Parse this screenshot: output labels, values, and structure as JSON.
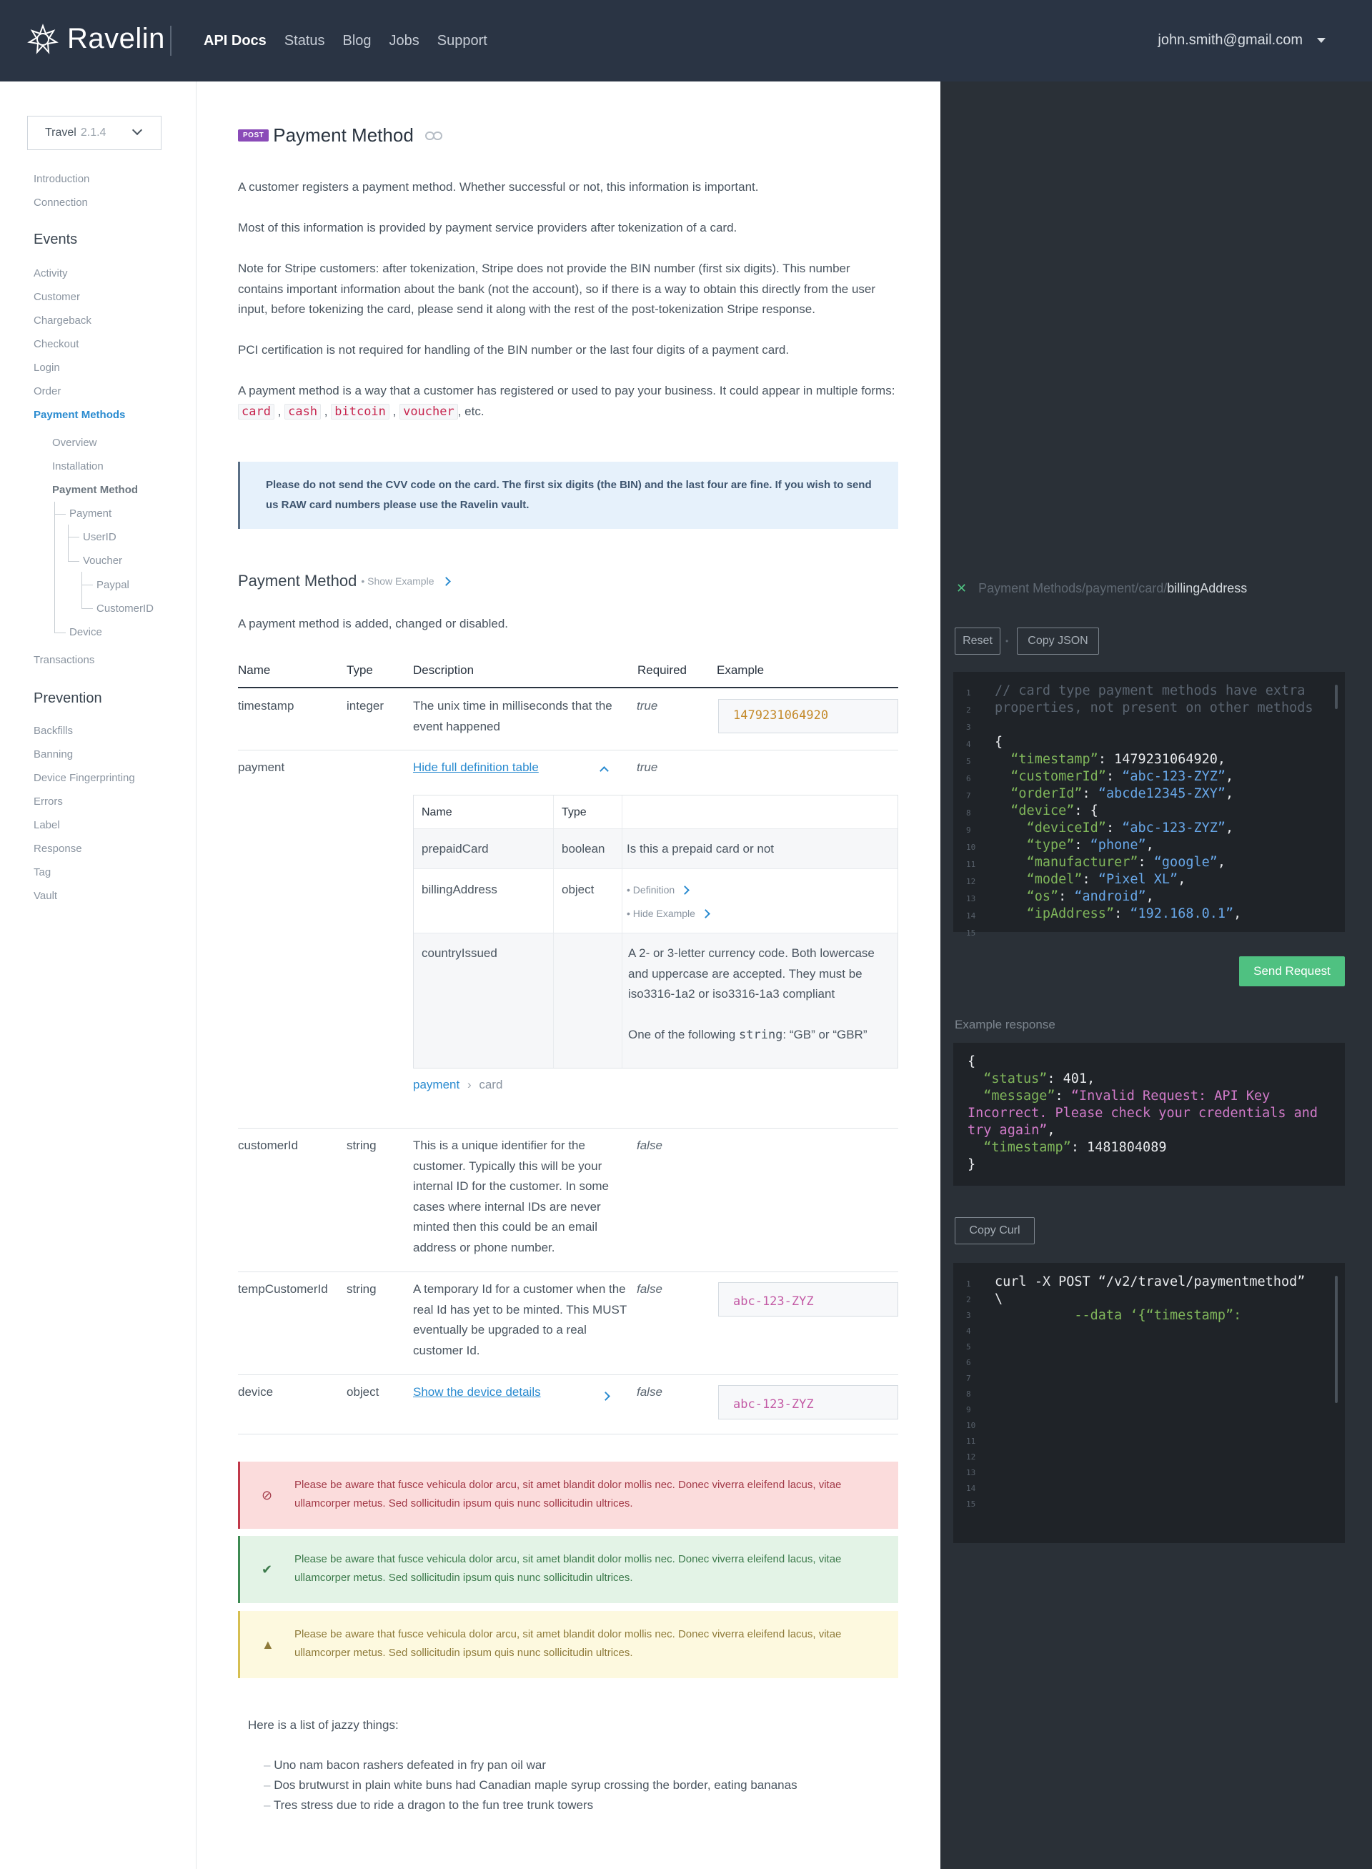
{
  "header": {
    "logo_text": "Ravelin",
    "nav": [
      {
        "label": "API Docs",
        "active": true
      },
      {
        "label": "Status",
        "active": false
      },
      {
        "label": "Blog",
        "active": false
      },
      {
        "label": "Jobs",
        "active": false
      },
      {
        "label": "Support",
        "active": false
      }
    ],
    "user_email": "john.smith@gmail.com"
  },
  "sidebar": {
    "version_label": "Travel",
    "version_number": "2.1.4",
    "intro": "Introduction",
    "connection": "Connection",
    "events_heading": "Events",
    "events": [
      "Activity",
      "Customer",
      "Chargeback",
      "Checkout",
      "Login",
      "Order",
      "Payment Methods"
    ],
    "payment_sub": [
      "Overview",
      "Installation",
      "Payment Method"
    ],
    "tree": [
      "Payment",
      "UserID",
      "Voucher",
      "Paypal",
      "CustomerID",
      "Device"
    ],
    "transactions": "Transactions",
    "prevention_heading": "Prevention",
    "prevention": [
      "Backfills",
      "Banning",
      "Device Fingerprinting",
      "Errors",
      "Label",
      "Response",
      "Tag",
      "Vault"
    ]
  },
  "content": {
    "method_badge": "POST",
    "title": "Payment Method",
    "p1": "A customer registers a payment method. Whether successful or not, this information is important.",
    "p2": "Most of this information is provided by payment service providers after tokenization of a card.",
    "p3": "Note for Stripe customers: after tokenization, Stripe does not provide the BIN number (first six digits). This number contains important information about the bank (not the account), so if there is a way to obtain this directly from the user input, before tokenizing the card, please send it along with the rest of the post-tokenization Stripe response.",
    "p4": "PCI certification is not required for handling of the BIN number or the last four digits of a payment card.",
    "p5_prefix": "A payment method is a way that a customer has registered or used to pay your business. It could appear in multiple forms:",
    "p5_codes": [
      "card",
      "cash",
      "bitcoin",
      "voucher"
    ],
    "p5_suffix": ", etc.",
    "info": "Please do not send the CVV code on the card. The first six digits (the BIN) and the last four are fine. If you wish to send us RAW card numbers please use the Ravelin vault.",
    "section_title": "Payment Method",
    "show_example": "Show Example",
    "section_desc": "A payment method is added, changed or disabled.",
    "table_headers": [
      "Name",
      "Type",
      "Description",
      "Required",
      "Example"
    ],
    "rows": {
      "timestamp": {
        "name": "timestamp",
        "type": "integer",
        "desc": "The unix time in milliseconds that the event happened",
        "req": "true",
        "example": "1479231064920"
      },
      "payment": {
        "name": "payment",
        "link": "Hide full definition table",
        "req": "true"
      },
      "customerId": {
        "name": "customerId",
        "type": "string",
        "desc": "This is a unique identifier for the customer. Typically this will be your internal ID for the customer. In some cases where internal IDs are never minted then this could be an email address or phone number.",
        "req": "false"
      },
      "tempCustomerId": {
        "name": "tempCustomerId",
        "type": "string",
        "desc": "A temporary Id for a customer when the real Id has yet to be minted. This MUST eventually be upgraded to a real customer Id.",
        "req": "false",
        "example": "abc-123-ZYZ"
      },
      "device": {
        "name": "device",
        "type": "object",
        "link": "Show the device details",
        "req": "false",
        "example": "abc-123-ZYZ"
      }
    },
    "nested": {
      "headers": [
        "Name",
        "Type"
      ],
      "prepaid": {
        "name": "prepaidCard",
        "type": "boolean",
        "desc": "Is this a prepaid card or not"
      },
      "billing": {
        "name": "billingAddress",
        "type": "object",
        "definition": "Definition",
        "hide_example": "Hide Example"
      },
      "country": {
        "name": "countryIssued",
        "desc": "A 2- or 3-letter currency code. Both lowercase and uppercase are accepted. They must be iso3316-1a2 or iso3316-1a3 compliant",
        "desc2_prefix": "One of the following",
        "desc2_code": "string",
        "desc2_suffix": ": “GB” or “GBR”"
      }
    },
    "crumb": [
      "payment",
      "card"
    ],
    "alerts": {
      "error": "Please be aware that fusce vehicula dolor arcu, sit amet blandit dolor mollis nec. Donec viverra eleifend lacus, vitae ullamcorper metus. Sed sollicitudin ipsum quis nunc sollicitudin ultrices.",
      "success": "Please be aware that fusce vehicula dolor arcu, sit amet blandit dolor mollis nec. Donec viverra eleifend lacus, vitae ullamcorper metus. Sed sollicitudin ipsum quis nunc sollicitudin ultrices.",
      "warning": "Please be aware that fusce vehicula dolor arcu, sit amet blandit dolor mollis nec. Donec viverra eleifend lacus, vitae ullamcorper metus. Sed sollicitudin ipsum quis nunc sollicitudin ultrices."
    },
    "list_intro": "Here is a list of jazzy things:",
    "list": [
      "Uno nam bacon rashers defeated in fry pan oil war",
      "Dos brutwurst in plain white buns had Canadian maple syrup crossing the border, eating bananas",
      "Tres stress due to ride a dragon to the fun tree trunk towers"
    ]
  },
  "panel": {
    "path_prefix": "Payment Methods/payment/card/",
    "path_current": "billingAddress",
    "reset": "Reset",
    "copy_json": "Copy JSON",
    "send_request": "Send Request",
    "example_response_label": "Example response",
    "copy_curl": "Copy Curl",
    "colors": {
      "send_button": "#4fc181",
      "panel_bg": "#2a3037",
      "code_bg": "#1f2328"
    }
  }
}
